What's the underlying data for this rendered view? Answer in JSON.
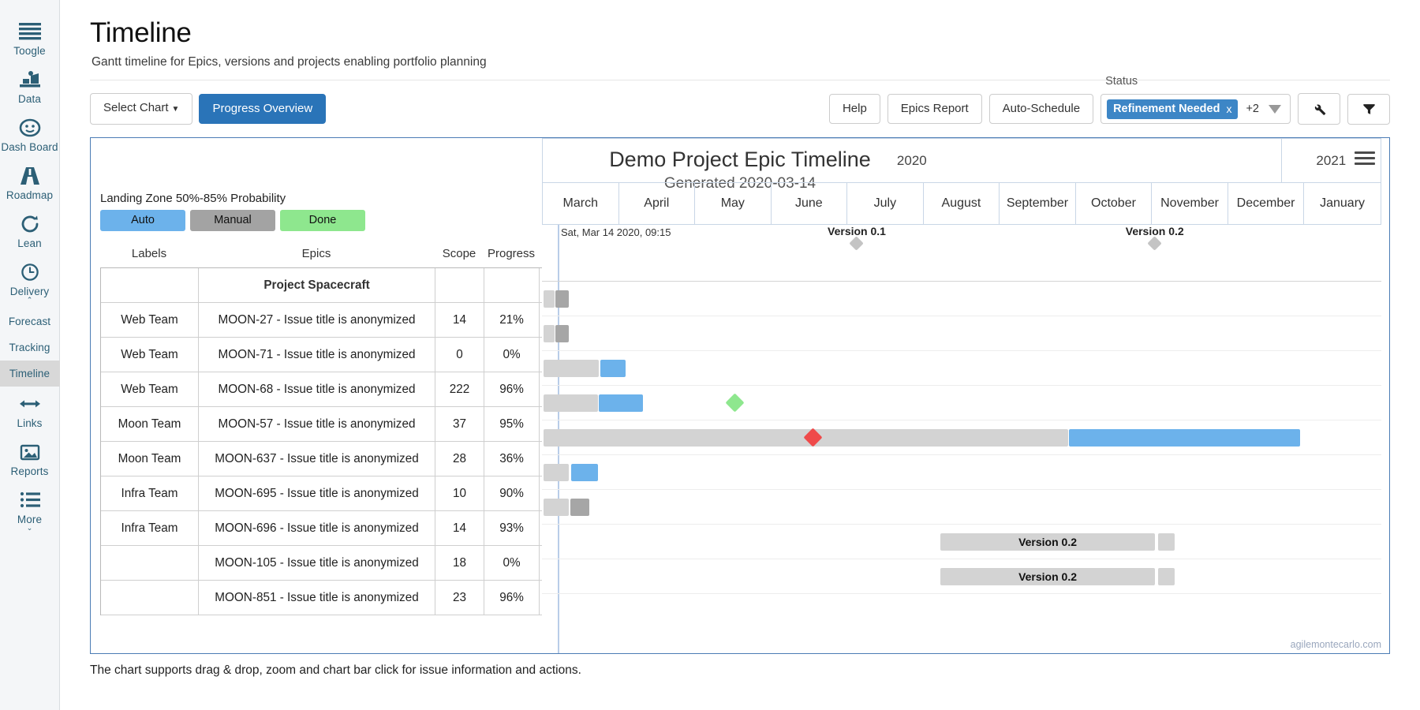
{
  "sidebar": {
    "items": [
      {
        "label": "Toogle",
        "icon": "hamburger-icon",
        "active": false
      },
      {
        "label": "Data",
        "icon": "data-chart-icon",
        "active": false
      },
      {
        "label": "Dash Board",
        "icon": "gauge-icon",
        "active": false
      },
      {
        "label": "Roadmap",
        "icon": "road-icon",
        "active": false
      },
      {
        "label": "Lean",
        "icon": "refresh-icon",
        "active": false
      },
      {
        "label": "Delivery",
        "icon": "clock-icon",
        "active": false
      },
      {
        "label": "Forecast",
        "icon": "",
        "active": false
      },
      {
        "label": "Tracking",
        "icon": "",
        "active": false
      },
      {
        "label": "Timeline",
        "icon": "",
        "active": true
      },
      {
        "label": "Links",
        "icon": "arrows-horizontal-icon",
        "active": false
      },
      {
        "label": "Reports",
        "icon": "image-icon",
        "active": false
      },
      {
        "label": "More",
        "icon": "list-icon",
        "active": false
      }
    ]
  },
  "header": {
    "title": "Timeline",
    "subtitle": "Gantt timeline for Epics, versions and projects enabling portfolio planning"
  },
  "toolbar": {
    "select_chart_label": "Select Chart",
    "progress_overview_label": "Progress Overview",
    "help_label": "Help",
    "epics_report_label": "Epics Report",
    "auto_schedule_label": "Auto-Schedule",
    "status_label": "Status",
    "status_chip": "Refinement Needed",
    "status_chip_close": "x",
    "status_more": "+2",
    "wrench_icon": "wrench-icon",
    "filter_icon": "funnel-icon",
    "accent_color": "#2a74b8"
  },
  "chart": {
    "title": "Demo Project Epic Timeline",
    "subtitle": "Generated 2020-03-14",
    "legend_title": "Landing Zone 50%-85% Probability",
    "legend": [
      {
        "label": "Auto",
        "color": "#6cb2eb"
      },
      {
        "label": "Manual",
        "color": "#a3a3a3"
      },
      {
        "label": "Done",
        "color": "#8ee78e"
      }
    ],
    "now_label": "Sat, Mar 14 2020, 09:15",
    "watermark": "agilemontecarlo.com",
    "columns": [
      "Labels",
      "Epics",
      "Scope",
      "Progress"
    ],
    "group_row": "Project Spacecraft",
    "version_markers": [
      {
        "label": "Version 0.1",
        "left_pct": 37.5
      },
      {
        "label": "Version 0.2",
        "left_pct": 73.0
      }
    ]
  },
  "chart_data": {
    "type": "bar",
    "title": "Demo Project Epic Timeline",
    "subtitle": "Generated 2020-03-14",
    "xlabel": "",
    "ylabel": "",
    "legend_position": "top-left",
    "grid": true,
    "years": [
      {
        "label": "2020",
        "width_pct": 88.2
      },
      {
        "label": "2021",
        "width_pct": 11.8
      }
    ],
    "categories": [
      "March",
      "April",
      "May",
      "June",
      "July",
      "August",
      "September",
      "October",
      "November",
      "December",
      "January"
    ],
    "rows": [
      {
        "label": "",
        "epic": "Project Spacecraft",
        "scope": "",
        "progress": "",
        "group": true,
        "bars": []
      },
      {
        "label": "Web Team",
        "epic": "MOON-27 - Issue title is anonymized",
        "scope": "14",
        "progress": "21%",
        "bars": [
          {
            "type": "grey",
            "left_pct": 0.2,
            "width_pct": 1.3
          },
          {
            "type": "grey-dark",
            "left_pct": 1.6,
            "width_pct": 1.6
          }
        ]
      },
      {
        "label": "Web Team",
        "epic": "MOON-71 - Issue title is anonymized",
        "scope": "0",
        "progress": "0%",
        "bars": [
          {
            "type": "grey",
            "left_pct": 0.2,
            "width_pct": 1.3
          },
          {
            "type": "grey-dark",
            "left_pct": 1.6,
            "width_pct": 1.6
          }
        ]
      },
      {
        "label": "Web Team",
        "epic": "MOON-68 - Issue title is anonymized",
        "scope": "222",
        "progress": "96%",
        "bars": [
          {
            "type": "grey",
            "left_pct": 0.2,
            "width_pct": 6.6
          },
          {
            "type": "blue",
            "left_pct": 7.0,
            "width_pct": 3.0
          }
        ]
      },
      {
        "label": "Moon Team",
        "epic": "MOON-57 - Issue title is anonymized",
        "scope": "37",
        "progress": "95%",
        "bars": [
          {
            "type": "grey",
            "left_pct": 0.2,
            "width_pct": 6.5
          },
          {
            "type": "blue",
            "left_pct": 6.8,
            "width_pct": 5.2
          }
        ],
        "diamonds": [
          {
            "color": "green",
            "left_pct": 22.2
          }
        ]
      },
      {
        "label": "Moon Team",
        "epic": "MOON-637 - Issue title is anonymized",
        "scope": "28",
        "progress": "36%",
        "bars": [
          {
            "type": "grey",
            "left_pct": 0.2,
            "width_pct": 62.5
          },
          {
            "type": "blue",
            "left_pct": 62.8,
            "width_pct": 27.5
          }
        ],
        "diamonds": [
          {
            "color": "red",
            "left_pct": 31.5
          }
        ]
      },
      {
        "label": "Infra Team",
        "epic": "MOON-695 - Issue title is anonymized",
        "scope": "10",
        "progress": "90%",
        "bars": [
          {
            "type": "grey",
            "left_pct": 0.2,
            "width_pct": 3.0
          },
          {
            "type": "blue",
            "left_pct": 3.5,
            "width_pct": 3.2
          }
        ]
      },
      {
        "label": "Infra Team",
        "epic": "MOON-696 - Issue title is anonymized",
        "scope": "14",
        "progress": "93%",
        "bars": [
          {
            "type": "grey",
            "left_pct": 0.2,
            "width_pct": 3.0
          },
          {
            "type": "grey-dark",
            "left_pct": 3.4,
            "width_pct": 2.2
          }
        ]
      },
      {
        "label": "",
        "epic": "MOON-105 - Issue title is anonymized",
        "scope": "18",
        "progress": "0%",
        "bars": [
          {
            "type": "version",
            "left_pct": 47.5,
            "width_pct": 25.5,
            "text": "Version 0.2"
          },
          {
            "type": "grey",
            "left_pct": 73.4,
            "width_pct": 2.0
          }
        ]
      },
      {
        "label": "",
        "epic": "MOON-851 - Issue title is anonymized",
        "scope": "23",
        "progress": "96%",
        "bars": [
          {
            "type": "version",
            "left_pct": 47.5,
            "width_pct": 25.5,
            "text": "Version 0.2"
          },
          {
            "type": "grey",
            "left_pct": 73.4,
            "width_pct": 2.0
          }
        ]
      }
    ]
  },
  "footer": {
    "note": "The chart supports drag & drop, zoom and chart bar click for issue information and actions."
  }
}
